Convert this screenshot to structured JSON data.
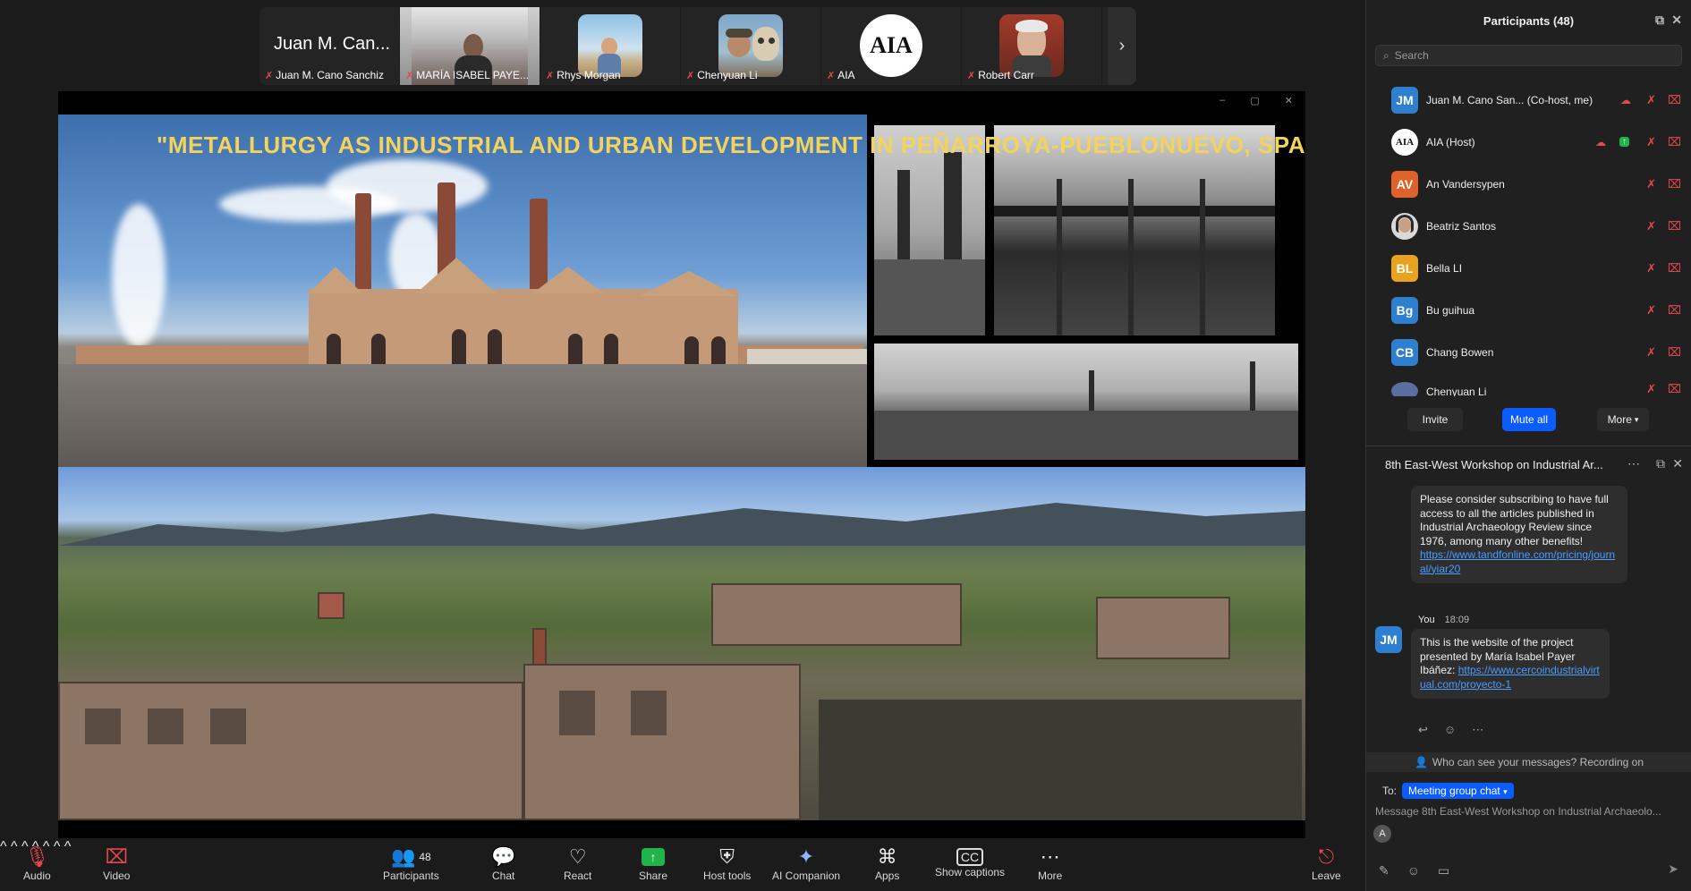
{
  "strip": {
    "tiles": [
      {
        "big_name": "Juan M. Can...",
        "name": "Juan M. Cano Sanchiz"
      },
      {
        "name": "MARÍA ISABEL PAYE..."
      },
      {
        "name": "Rhys Morgan"
      },
      {
        "name": "Chenyuan Li"
      },
      {
        "name": "AIA",
        "logo": "AIA"
      },
      {
        "name": "Robert Carr"
      }
    ],
    "next_icon": "›"
  },
  "share": {
    "slide_title": "\"METALLURGY AS INDUSTRIAL AND URBAN DEVELOPMENT  IN PEÑARROYA-PUEBLONUEVO, SPAIN\"",
    "window_controls": [
      "–",
      "▢",
      "✕"
    ]
  },
  "toolbar": {
    "audio": "Audio",
    "video": "Video",
    "participants": "Participants",
    "participants_count": "48",
    "chat": "Chat",
    "react": "React",
    "share": "Share",
    "host_tools": "Host tools",
    "ai_companion": "AI Companion",
    "apps": "Apps",
    "show_captions": "Show captions",
    "more": "More",
    "leave": "Leave"
  },
  "panel": {
    "title": "Participants (48)",
    "search_placeholder": "Search",
    "participants": [
      {
        "initials": "JM",
        "color": "#2e7fd0",
        "name": "Juan M. Cano San...  (Co-host, me)"
      },
      {
        "initials": "AIA",
        "color": "#ffffff",
        "name": "AIA (Host)"
      },
      {
        "initials": "AV",
        "color": "#e0622b",
        "name": "An Vandersypen"
      },
      {
        "initials": "",
        "color": "#d9d9d9",
        "name": "Beatriz Santos"
      },
      {
        "initials": "BL",
        "color": "#e8a21f",
        "name": "Bella LI"
      },
      {
        "initials": "Bg",
        "color": "#2e7fd0",
        "name": "Bu guihua"
      },
      {
        "initials": "CB",
        "color": "#2e7fd0",
        "name": "Chang Bowen"
      },
      {
        "initials": "",
        "color": "#5a6fa0",
        "name": "Chenyuan Li"
      }
    ],
    "invite": "Invite",
    "mute_all": "Mute all",
    "more": "More"
  },
  "chat": {
    "title": "8th East-West Workshop on Industrial Ar...",
    "msg1_text": "Please consider subscribing to have full access to all the articles published in Industrial Archaeology Review since 1976, among many other benefits!",
    "msg1_link": "https://www.tandfonline.com/pricing/journal/yiar20",
    "msg2_sender": "You",
    "msg2_time": "18:09",
    "msg2_avatar": "JM",
    "msg2_text": "This is the website of the project presented by María Isabel Payer Ibáñez:",
    "msg2_link": "https://www.cercoindustrialvirtual.com/proyecto-1",
    "notice": "Who can see your messages? Recording on",
    "to_label": "To:",
    "to_chip": "Meeting group chat",
    "input_placeholder": "Message 8th East-West Workshop on Industrial Archaeolo...",
    "input_avatar": "A"
  }
}
